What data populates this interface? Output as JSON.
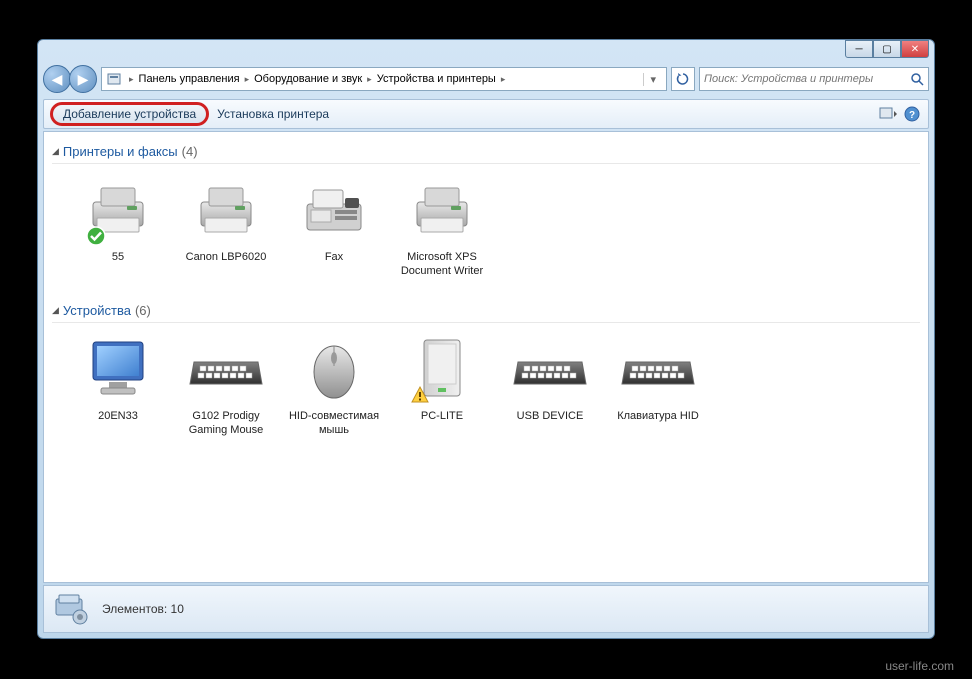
{
  "breadcrumb": {
    "items": [
      "Панель управления",
      "Оборудование и звук",
      "Устройства и принтеры"
    ]
  },
  "search": {
    "placeholder": "Поиск: Устройства и принтеры"
  },
  "toolbar": {
    "add_device": "Добавление устройства",
    "install_printer": "Установка принтера"
  },
  "groups": [
    {
      "title": "Принтеры и факсы",
      "count": "(4)",
      "items": [
        {
          "label": "55",
          "icon": "printer-default",
          "badge": "check"
        },
        {
          "label": "Canon LBP6020",
          "icon": "printer"
        },
        {
          "label": "Fax",
          "icon": "fax"
        },
        {
          "label": "Microsoft XPS Document Writer",
          "icon": "printer"
        }
      ]
    },
    {
      "title": "Устройства",
      "count": "(6)",
      "items": [
        {
          "label": "20EN33",
          "icon": "monitor"
        },
        {
          "label": "G102 Prodigy Gaming Mouse",
          "icon": "keyboard"
        },
        {
          "label": "HID-совместимая мышь",
          "icon": "mouse"
        },
        {
          "label": "PC-LITE",
          "icon": "drive",
          "badge": "warn"
        },
        {
          "label": "USB DEVICE",
          "icon": "keyboard"
        },
        {
          "label": "Клавиатура HID",
          "icon": "keyboard"
        }
      ]
    }
  ],
  "status": {
    "label": "Элементов: 10"
  },
  "watermark": "user-life.com"
}
